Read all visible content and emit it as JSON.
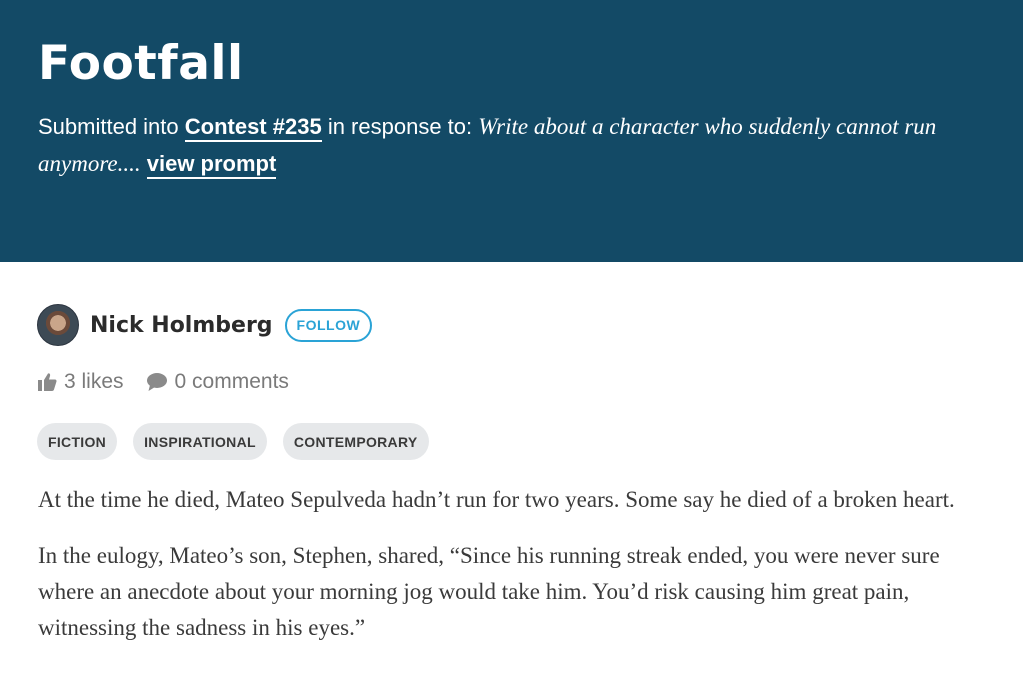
{
  "header": {
    "title": "Footfall",
    "submitted_prefix": "Submitted into ",
    "contest_link": "Contest #235",
    "response_text": " in response to: ",
    "prompt": "Write about a character who suddenly cannot run anymore....",
    "view_prompt": "view prompt"
  },
  "author": {
    "name": "Nick Holmberg",
    "follow_label": "FOLLOW"
  },
  "stats": {
    "likes": "3 likes",
    "comments": "0 comments"
  },
  "tags": [
    "FICTION",
    "INSPIRATIONAL",
    "CONTEMPORARY"
  ],
  "story": {
    "paragraphs": [
      "At the time he died, Mateo Sepulveda hadn’t run for two years. Some say he died of a broken heart.",
      "In the eulogy, Mateo’s son, Stephen, shared, “Since his running streak ended, you were never sure where an anecdote about your morning jog would take him. You’d risk causing him great pain, witnessing the sadness in his eyes.”"
    ]
  },
  "colors": {
    "header_bg": "#134a66",
    "accent": "#2aa3d6",
    "tag_bg": "#e6e8ea"
  }
}
